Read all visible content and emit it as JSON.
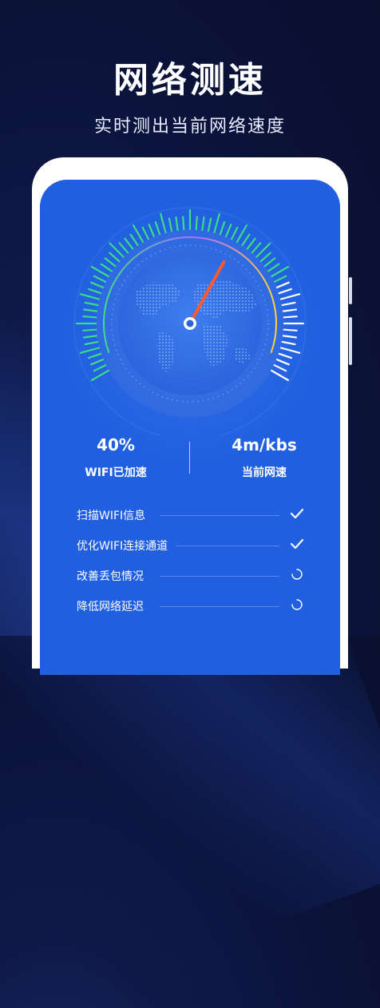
{
  "promo": {
    "title": "网络测速",
    "subtitle": "实时测出当前网络速度"
  },
  "speed_gauge": {
    "needle_level": 0.62,
    "ticks_green": "#3ddc84",
    "ticks_white": "#ffffff",
    "needle_color": "#ff5a2e",
    "icon": "world-map-icon"
  },
  "stats": {
    "boost": {
      "value": "40%",
      "label": "WIFI已加速"
    },
    "speed": {
      "value": "4m/kbs",
      "label": "当前网速"
    }
  },
  "tasks": [
    {
      "label": "扫描WIFI信息",
      "status": "done"
    },
    {
      "label": "优化WIFI连接通道",
      "status": "done"
    },
    {
      "label": "改善丢包情况",
      "status": "loading"
    },
    {
      "label": "降低网络延迟",
      "status": "loading"
    }
  ],
  "colors": {
    "background": "#0b1238",
    "screen": "#1f5fe0",
    "text": "#ffffff"
  }
}
